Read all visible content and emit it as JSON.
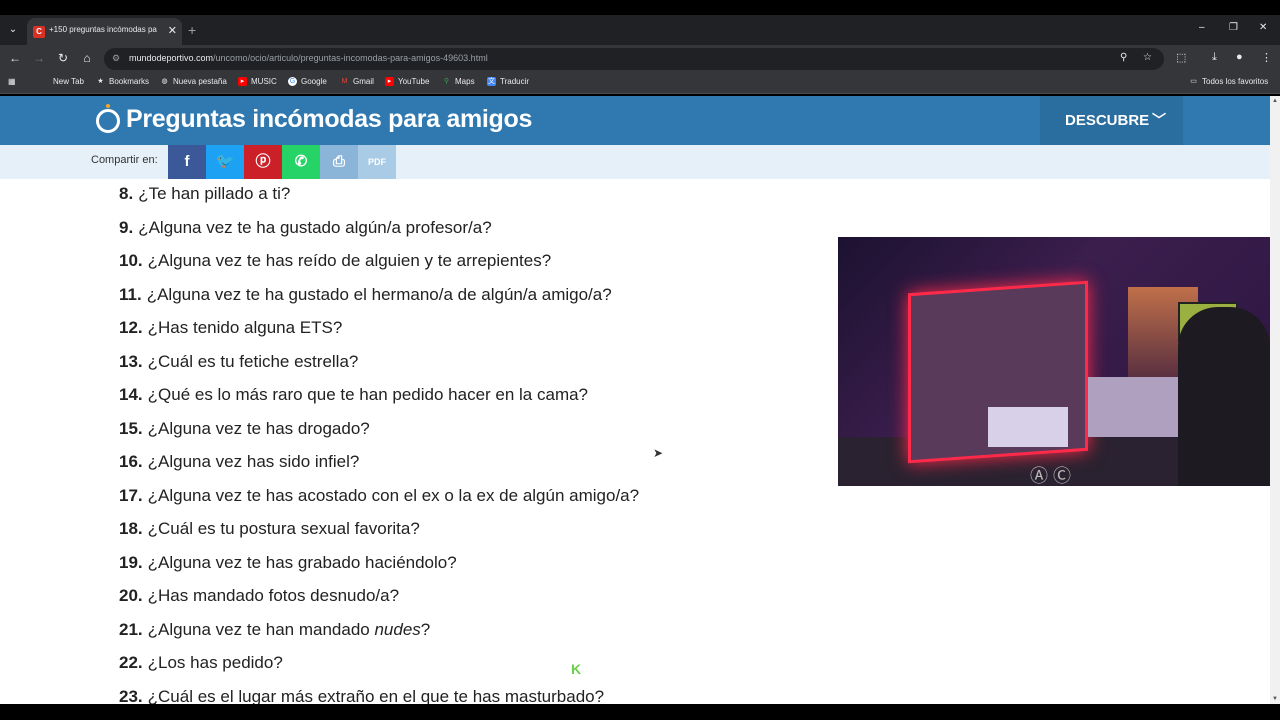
{
  "browser": {
    "tab_title": "+150 preguntas incómodas pa",
    "url_host": "mundodeportivo.com",
    "url_path": "/uncomo/ocio/articulo/preguntas-incomodas-para-amigos-49603.html"
  },
  "bookmarks": [
    {
      "label": "New Tab"
    },
    {
      "label": "Bookmarks"
    },
    {
      "label": "Nueva pestaña"
    },
    {
      "label": "MUSIC"
    },
    {
      "label": "Google"
    },
    {
      "label": "Gmail"
    },
    {
      "label": "YouTube"
    },
    {
      "label": "Maps"
    },
    {
      "label": "Traducir"
    }
  ],
  "bookmarks_all": "Todos los favoritos",
  "site": {
    "title": "Preguntas incómodas para amigos",
    "descubre": "DESCUBRE",
    "share_label": "Compartir en:",
    "pdf_label": "PDF"
  },
  "questions": [
    {
      "num": "8.",
      "text": "¿Te han pillado a ti?"
    },
    {
      "num": "9.",
      "text": "¿Alguna vez te ha gustado algún/a profesor/a?"
    },
    {
      "num": "10.",
      "text": "¿Alguna vez te has reído de alguien y te arrepientes?"
    },
    {
      "num": "11.",
      "text": "¿Alguna vez te ha gustado el hermano/a de algún/a amigo/a?"
    },
    {
      "num": "12.",
      "text": "¿Has tenido alguna ETS?"
    },
    {
      "num": "13.",
      "text": "¿Cuál es tu fetiche estrella?"
    },
    {
      "num": "14.",
      "text": "¿Qué es lo más raro que te han pedido hacer en la cama?"
    },
    {
      "num": "15.",
      "text": "¿Alguna vez te has drogado?"
    },
    {
      "num": "16.",
      "text": "¿Alguna vez has sido infiel?"
    },
    {
      "num": "17.",
      "text": "¿Alguna vez te has acostado con el ex o la ex de algún amigo/a?"
    },
    {
      "num": "18.",
      "text": "¿Cuál es tu postura sexual favorita?"
    },
    {
      "num": "19.",
      "text": "¿Alguna vez te has grabado haciéndolo?"
    },
    {
      "num": "20.",
      "text": "¿Has mandado fotos desnudo/a?"
    },
    {
      "num": "21.",
      "text": "¿Alguna vez te han mandado ",
      "em": "nudes",
      "after": "?"
    },
    {
      "num": "22.",
      "text": "¿Los has pedido?"
    },
    {
      "num": "23.",
      "text": "¿Cuál es el lugar más extraño en el que te has masturbado?"
    }
  ],
  "colors": {
    "header": "#2f79b0",
    "facebook": "#3b5998",
    "twitter": "#1da1f2",
    "pinterest": "#cb2027",
    "whatsapp": "#25d366",
    "print": "#8ab4d8",
    "pdf": "#a9cbe6"
  }
}
